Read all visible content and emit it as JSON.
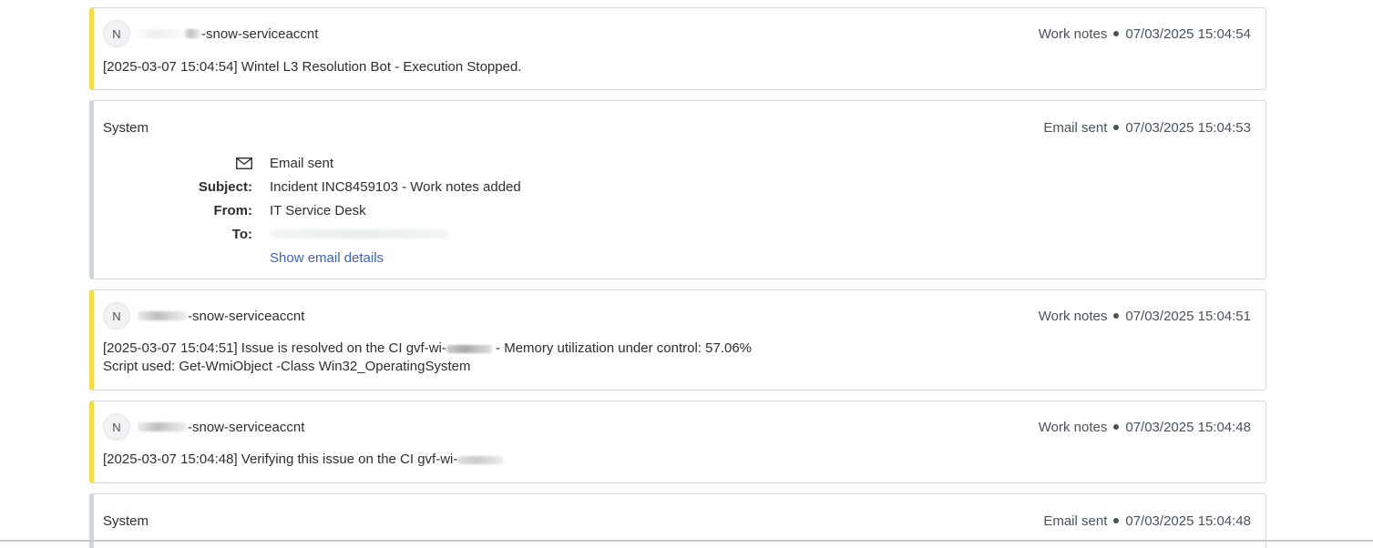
{
  "entries": [
    {
      "kind": "work_notes",
      "avatar": "N",
      "author": "-snow-serviceaccnt",
      "type_label": "Work notes",
      "timestamp": "07/03/2025 15:04:54",
      "lines": [
        "[2025-03-07 15:04:54] Wintel L3 Resolution Bot - Execution Stopped."
      ]
    },
    {
      "kind": "email",
      "author": "System",
      "type_label": "Email sent",
      "timestamp": "07/03/2025 15:04:53",
      "email_status": "Email sent",
      "subject_label": "Subject:",
      "subject": "Incident INC8459103 - Work notes added",
      "from_label": "From:",
      "from": "IT Service Desk",
      "to_label": "To:",
      "details_link": "Show email details"
    },
    {
      "kind": "work_notes",
      "avatar": "N",
      "author": "-snow-serviceaccnt",
      "type_label": "Work notes",
      "timestamp": "07/03/2025 15:04:51",
      "line1_prefix": "[2025-03-07 15:04:51] Issue is resolved on the CI gvf-wi-",
      "line1_suffix": " - Memory utilization under control: 57.06%",
      "line2": "Script used: Get-WmiObject -Class Win32_OperatingSystem"
    },
    {
      "kind": "work_notes",
      "avatar": "N",
      "author": "-snow-serviceaccnt",
      "type_label": "Work notes",
      "timestamp": "07/03/2025 15:04:48",
      "line1_prefix": "[2025-03-07 15:04:48] Verifying this issue on the CI gvf-wi-"
    },
    {
      "kind": "email",
      "author": "System",
      "type_label": "Email sent",
      "timestamp": "07/03/2025 15:04:48"
    }
  ],
  "colors": {
    "work_notes_accent": "#f3dc46",
    "system_accent": "#d3d6d9",
    "link": "#3d62c7"
  },
  "icons": {
    "email": "envelope-icon"
  }
}
